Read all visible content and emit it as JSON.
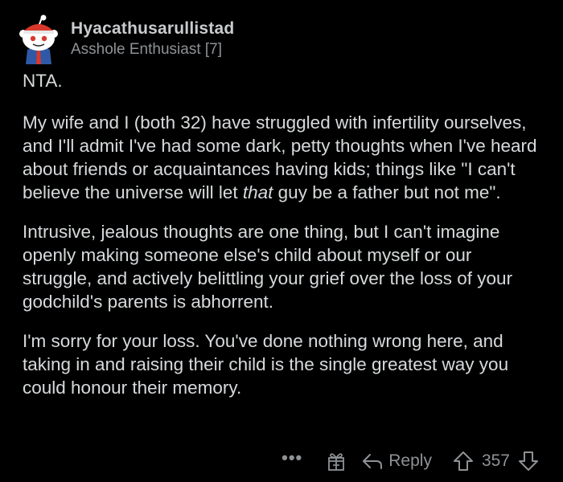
{
  "comment": {
    "author": {
      "username": "Hyacathusarullistad",
      "flair": "Asshole Enthusiast [7]"
    },
    "paragraphs": [
      "NTA.",
      "My wife and I (both 32) have struggled with infertility ourselves, and I'll admit I've had some dark, petty thoughts when I've heard about friends or acquaintances having kids; things like \"I can't believe the universe will let ",
      "Intrusive, jealous thoughts are one thing, but I can't imagine openly making someone else's child about myself or our struggle, and actively belittling your grief over the loss of your godchild's parents is abhorrent.",
      "I'm sorry for your loss. You've done nothing wrong here, and taking in and raising their child is the single greatest way you could honour their memory."
    ],
    "paragraph2_italic": "that",
    "paragraph2_tail": " guy be a father but not me\".",
    "actions": {
      "more": "•••",
      "reply_label": "Reply",
      "score": "357"
    }
  },
  "icons": {
    "avatar": "reddit-snoo-avatar",
    "more": "more-options-icon",
    "gift": "award-gift-icon",
    "reply": "reply-arrow-icon",
    "upvote": "upvote-arrow-icon",
    "downvote": "downvote-arrow-icon"
  },
  "colors": {
    "background": "#000000",
    "text": "#d7dadc",
    "muted": "#8e9295",
    "avatar_accent": "#2f59a6",
    "avatar_red": "#d8382b"
  }
}
